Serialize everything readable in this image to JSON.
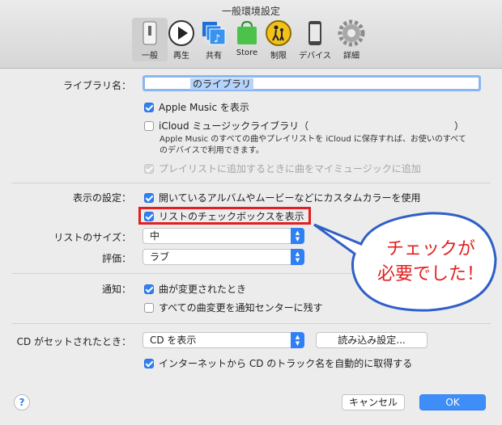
{
  "window": {
    "title": "一般環境設定"
  },
  "toolbar": {
    "items": [
      {
        "label": "一般",
        "icon": "general-icon"
      },
      {
        "label": "再生",
        "icon": "play-icon"
      },
      {
        "label": "共有",
        "icon": "share-icon"
      },
      {
        "label": "Store",
        "icon": "store-icon"
      },
      {
        "label": "制限",
        "icon": "parental-icon"
      },
      {
        "label": "デバイス",
        "icon": "device-icon"
      },
      {
        "label": "詳細",
        "icon": "gear-icon"
      }
    ]
  },
  "library": {
    "label": "ライブラリ名：",
    "name_value": "のライブラリ",
    "show_apple_music": "Apple Music を表示",
    "icloud_music": "iCloud ミュージックライブラリ（",
    "icloud_close": "）",
    "icloud_note_1": "Apple Music のすべての曲やプレイリストを iCloud に保存すれば、お使いのすべて",
    "icloud_note_2": "のデバイスで利用できます。",
    "add_to_my_music": "プレイリストに追加するときに曲をマイミュージックに追加"
  },
  "display": {
    "label": "表示の設定：",
    "custom_color": "開いているアルバムやムービーなどにカスタムカラーを使用",
    "show_checkboxes": "リストのチェックボックスを表示",
    "list_size_label": "リストのサイズ：",
    "list_size_value": "中",
    "rating_label": "評価：",
    "rating_value": "ラブ"
  },
  "notifications": {
    "label": "通知：",
    "song_changes": "曲が変更されたとき",
    "all_changes": "すべての曲変更を通知センターに残す"
  },
  "cd": {
    "label": "CD がセットされたとき：",
    "action_value": "CD を表示",
    "import_settings": "読み込み設定...",
    "auto_names": "インターネットから CD のトラック名を自動的に取得する"
  },
  "footer": {
    "help": "?",
    "cancel": "キャンセル",
    "ok": "OK"
  },
  "annotation": {
    "line1": "チェックが",
    "line2": "必要でした！"
  },
  "colors": {
    "accent": "#2f7ff5",
    "annotation_red": "#e31f1f"
  }
}
